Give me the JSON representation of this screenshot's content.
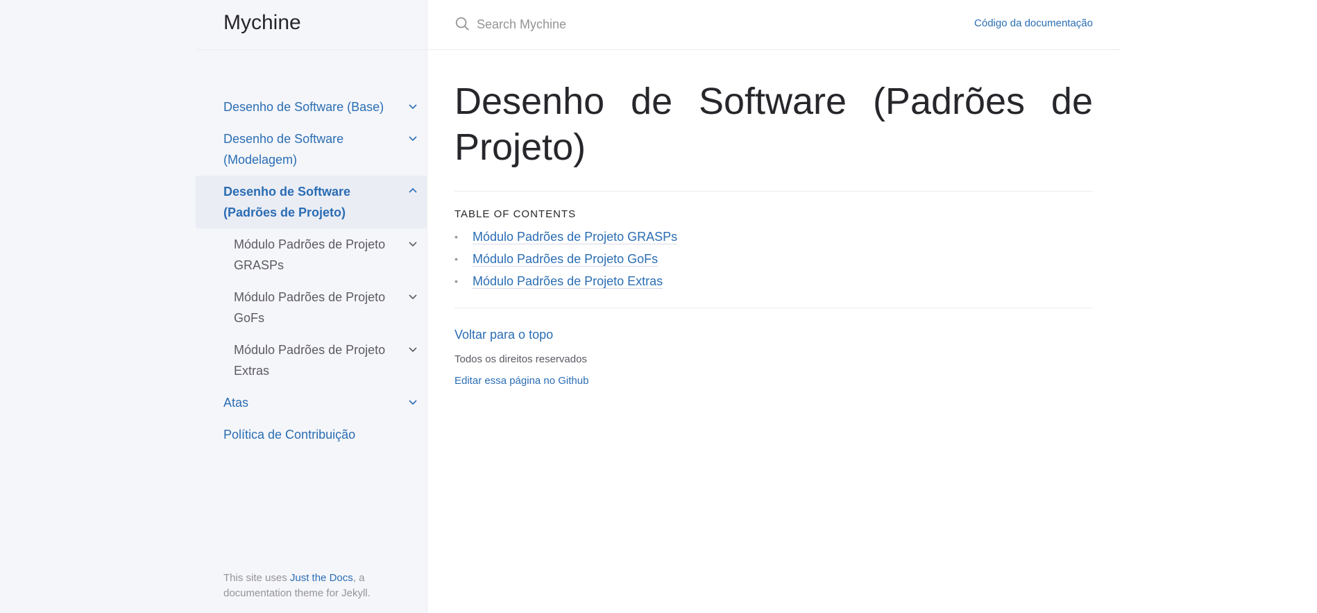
{
  "site": {
    "title": "Mychine"
  },
  "search": {
    "placeholder": "Search Mychine"
  },
  "header": {
    "aux_link": "Código da documentação"
  },
  "nav": {
    "items": [
      {
        "label": "Desenho de Software (Base)"
      },
      {
        "label": "Desenho de Software (Modelagem)"
      },
      {
        "label": "Desenho de Software (Padrões de Projeto)"
      },
      {
        "label": "Módulo Padrões de Projeto GRASPs"
      },
      {
        "label": "Módulo Padrões de Projeto GoFs"
      },
      {
        "label": "Módulo Padrões de Projeto Extras"
      },
      {
        "label": "Atas"
      },
      {
        "label": "Política de Contribuição"
      }
    ]
  },
  "sidebar_footer": {
    "prefix": "This site uses ",
    "link": "Just the Docs",
    "suffix": ", a documentation theme for Jekyll."
  },
  "main": {
    "title": "Desenho de Software (Padrões de Projeto)",
    "toc_heading": "TABLE OF CONTENTS",
    "toc": [
      {
        "label": "Módulo Padrões de Projeto GRASPs"
      },
      {
        "label": "Módulo Padrões de Projeto GoFs"
      },
      {
        "label": "Módulo Padrões de Projeto Extras"
      }
    ],
    "back_to_top": "Voltar para o topo",
    "rights": "Todos os direitos reservados",
    "edit_link": "Editar essa página no Github"
  },
  "colors": {
    "link": "#2a6db3",
    "sidebar_bg": "#f5f6fa",
    "active_bg": "#ebedf5",
    "text": "#27262b"
  }
}
